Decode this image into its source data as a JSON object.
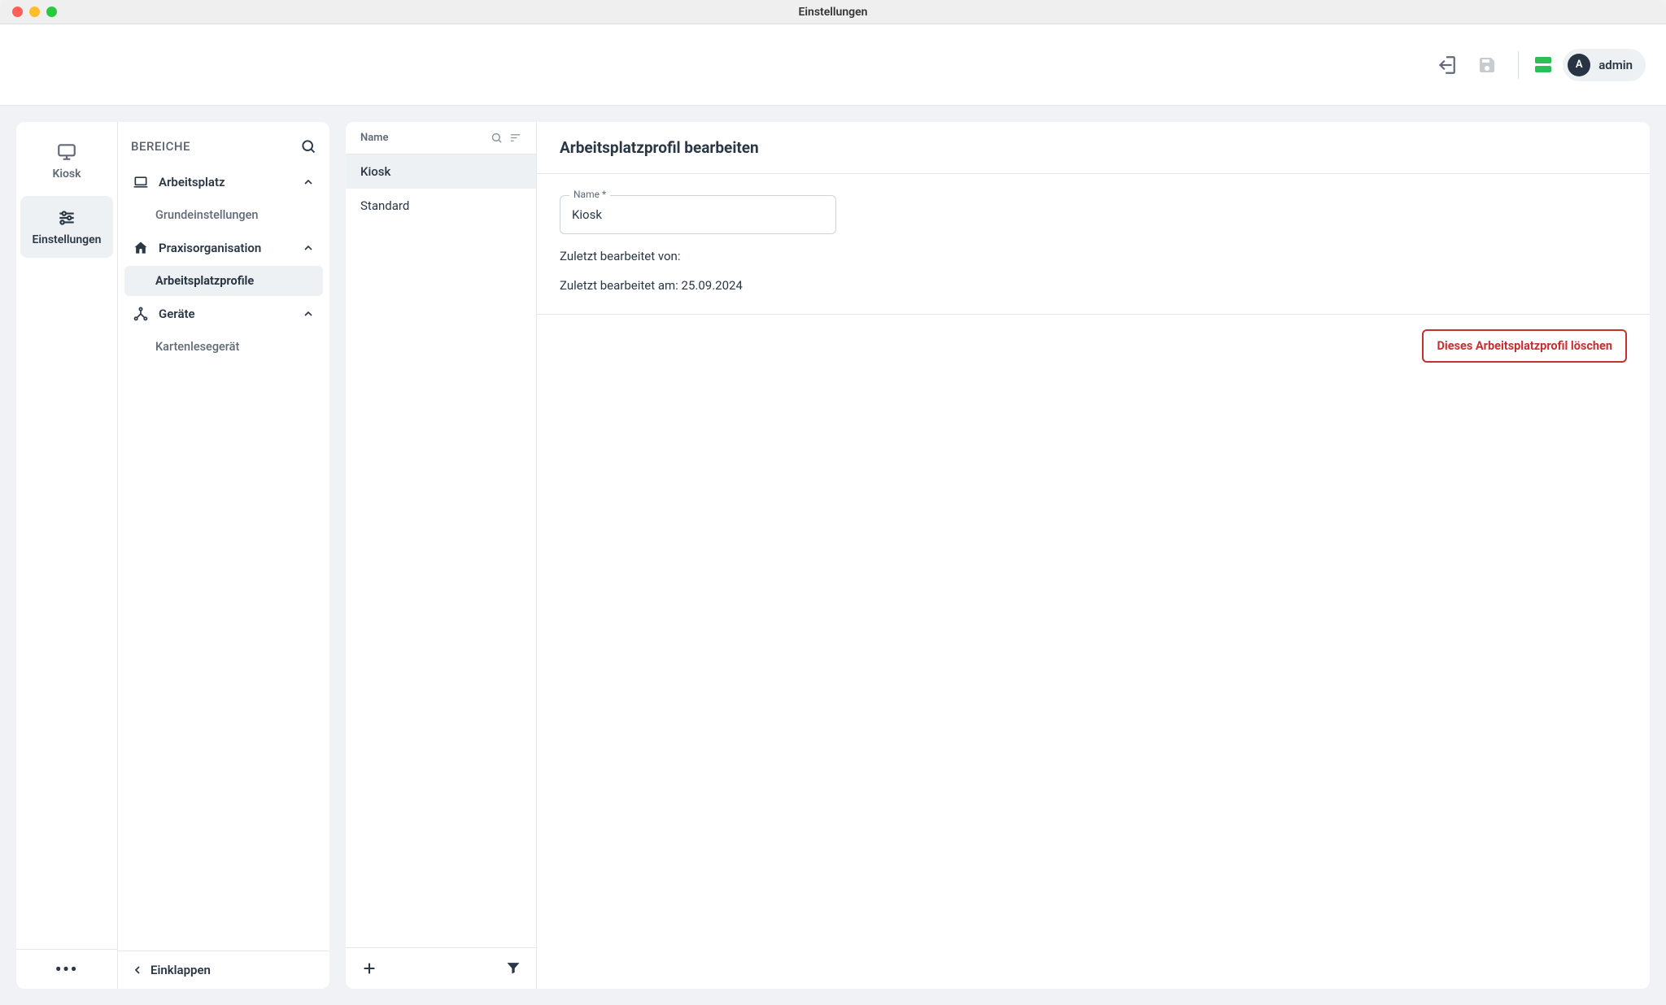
{
  "window": {
    "title": "Einstellungen"
  },
  "header": {
    "status_color": "#2bbf5a",
    "user": {
      "initial": "A",
      "name": "admin"
    }
  },
  "nav_rail": {
    "items": [
      {
        "label": "Kiosk",
        "icon": "monitor"
      },
      {
        "label": "Einstellungen",
        "icon": "tune"
      }
    ],
    "active_index": 1
  },
  "sidebar": {
    "title": "BEREICHE",
    "sections": [
      {
        "label": "Arbeitsplatz",
        "icon": "laptop",
        "expanded": true,
        "children": [
          {
            "label": "Grundeinstellungen",
            "active": false
          }
        ]
      },
      {
        "label": "Praxisorganisation",
        "icon": "home-heart",
        "expanded": true,
        "children": [
          {
            "label": "Arbeitsplatzprofile",
            "active": true
          }
        ]
      },
      {
        "label": "Geräte",
        "icon": "hub",
        "expanded": true,
        "children": [
          {
            "label": "Kartenlesegerät",
            "active": false
          }
        ]
      }
    ],
    "collapse_label": "Einklappen"
  },
  "list": {
    "column_header": "Name",
    "items": [
      {
        "label": "Kiosk",
        "selected": true
      },
      {
        "label": "Standard",
        "selected": false
      }
    ]
  },
  "detail": {
    "heading": "Arbeitsplatzprofil bearbeiten",
    "name_field_label": "Name *",
    "name_field_value": "Kiosk",
    "last_edited_by_label": "Zuletzt bearbeitet von:",
    "last_edited_by_value": "",
    "last_edited_at_label": "Zuletzt bearbeitet am:",
    "last_edited_at_value": "25.09.2024",
    "delete_label": "Dieses Arbeitsplatzprofil löschen"
  }
}
